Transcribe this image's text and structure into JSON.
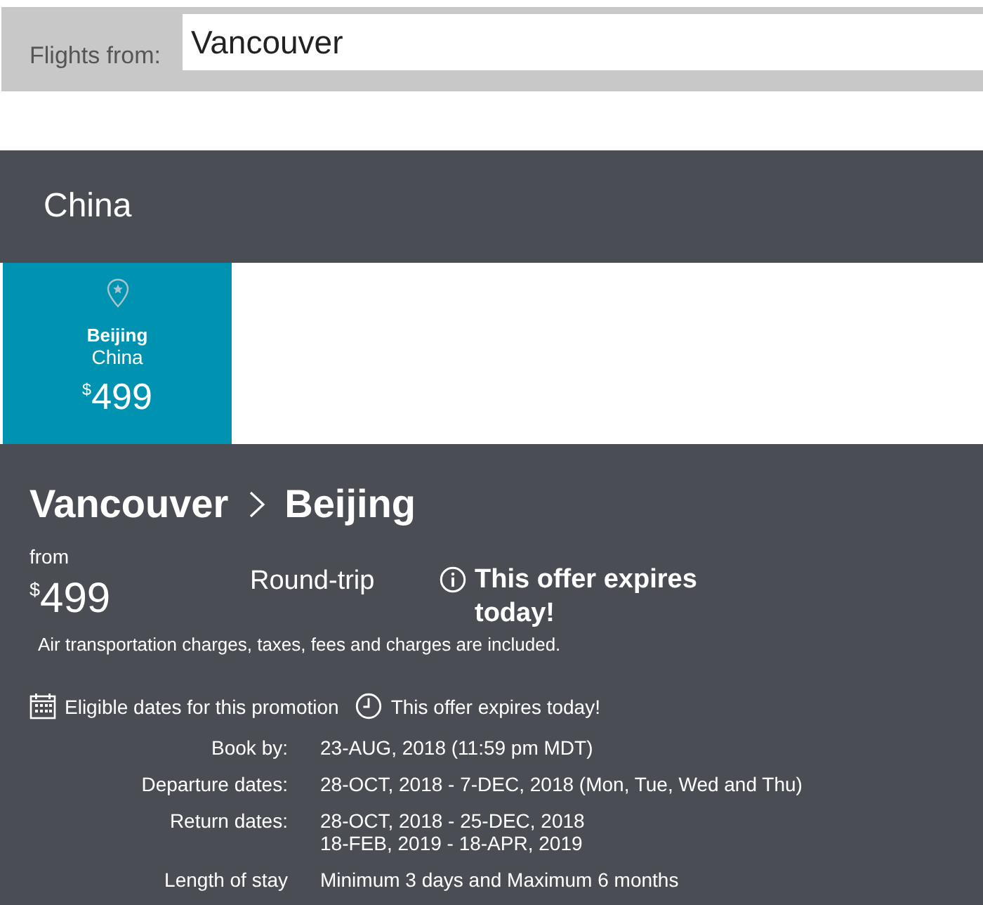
{
  "search": {
    "label": "Flights from:",
    "value": "Vancouver"
  },
  "region": {
    "title": "China"
  },
  "destinations": [
    {
      "city": "Beijing",
      "country": "China",
      "currency": "$",
      "price": "499",
      "selected": true
    }
  ],
  "offer": {
    "origin": "Vancouver",
    "destination": "Beijing",
    "from_label": "from",
    "currency": "$",
    "price": "499",
    "trip_type": "Round-trip",
    "expiry_notice": "This offer expires today!",
    "includes_note": "Air transportation charges, taxes, fees and charges are included.",
    "eligible_label": "Eligible dates for this promotion",
    "expiry_label": "This offer expires today!",
    "details": [
      {
        "label": "Book by:",
        "values": [
          "23-AUG, 2018 (11:59 pm MDT)"
        ]
      },
      {
        "label": "Departure dates:",
        "values": [
          "28-OCT, 2018 - 7-DEC, 2018 (Mon, Tue, Wed and Thu)"
        ]
      },
      {
        "label": "Return dates:",
        "values": [
          "28-OCT, 2018 - 25-DEC, 2018",
          "18-FEB, 2019 - 18-APR, 2019"
        ]
      },
      {
        "label": "Length of stay",
        "values": [
          "Minimum 3 days and Maximum 6 months"
        ]
      }
    ]
  }
}
